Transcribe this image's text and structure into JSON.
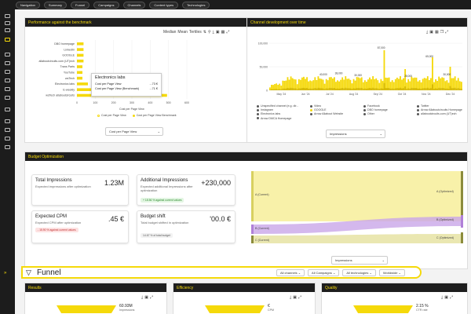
{
  "topbar": {
    "buttons": [
      "Navigation",
      "Summary",
      "Funnel",
      "Campaigns",
      "Channels",
      "Content types",
      "Technologies"
    ]
  },
  "benchmark": {
    "title": "Performance against the benchmark",
    "toolbar": [
      "Median",
      "Mean",
      "Tertiles"
    ],
    "labels": [
      "DBO homepage",
      "LinkedIn",
      "GOOGLE",
      "allaboutcircuits.com (UT)ech",
      "Trans Parts",
      "YouTube",
      "wsTech",
      "Electronics labs",
      "E-weekly",
      "wsTech allaboutcircuits"
    ],
    "bar_fractions": [
      0.06,
      0.06,
      0.06,
      0.06,
      0.05,
      0.05,
      0.05,
      0.1,
      0.33,
      0.82
    ],
    "x_ticks": [
      "0",
      "100",
      "200",
      "300",
      "400",
      "500",
      "600"
    ],
    "x_label": "Cost per Page View",
    "legend": [
      "Cost per Page View",
      "Cost per Page View Benchmark"
    ],
    "select": "Cost per Page View",
    "tooltip": {
      "title": "Electronics labs",
      "rows": [
        {
          "label": "Cost per Page View",
          "value": "...73 €"
        },
        {
          "label": "Cost per Page View (Benchmark)",
          "value": "...71 €"
        }
      ]
    }
  },
  "channel": {
    "title": "Channel development over time",
    "y_ticks": [
      "100,000",
      "50,000",
      "0"
    ],
    "x_ticks": [
      "May '24",
      "Jun '24",
      "Jul '24",
      "Aug '24",
      "Sep '24",
      "Oct '24",
      "Nov '24",
      "Dec '24"
    ],
    "annotations": [
      "40,000",
      "38,000",
      "87,000",
      "65,000",
      "30,000",
      "28,000",
      "30,000"
    ],
    "legend": [
      "Unspecified channel (e.g. dir...",
      "Video",
      "Facebook",
      "Twitter",
      "Instagram",
      "GOOGLE",
      "DBO homepage",
      "Arrow Allaboutcircuits Homepage",
      "Electronics labs",
      "Arrow Allabout Website",
      "Other",
      "allaboutcircuits.com (UT)ech",
      "Arrow DMCA Homepage"
    ],
    "legend_colors": [
      "#555555",
      "#555555",
      "#555555",
      "#555555",
      "#555555",
      "#f5d90a",
      "#555555",
      "#555555",
      "#555555",
      "#555555",
      "#555555",
      "#555555",
      "#555555"
    ],
    "select": "Impressions"
  },
  "budget": {
    "title": "Budget Optimization",
    "kpis": [
      {
        "title": "Total Impressions",
        "sub": "Expected impressions after optimization",
        "value": "1.23M"
      },
      {
        "title": "Additional Impressions",
        "sub": "Expected additional Impressions after optimization",
        "value": "+230,000",
        "badge": "+ 18.56 % against current values"
      },
      {
        "title": "Expected CPM",
        "sub": "Expected CPM after optimization",
        "value": ".45 €",
        "badge": "- 15.90 % against current values"
      },
      {
        "title": "Budget shift",
        "sub": "Total budget shifted in optimization",
        "value": "'00.0 €",
        "badge": "14.67 % of total budget"
      }
    ],
    "sankey_left": [
      "A (Current)",
      "B (Current)",
      "C (Current)"
    ],
    "sankey_right": [
      "A (Optimized)",
      "B (Optimized)",
      "C (Optimized)"
    ],
    "select": "Impressions"
  },
  "funnel": {
    "title": "Funnel",
    "filters": [
      "All channels",
      "All Campaigns",
      "All technologies",
      "Worldwide"
    ]
  },
  "bottom_cards": [
    {
      "title": "Results",
      "value": "60.93M",
      "sub": "Impressions"
    },
    {
      "title": "Efficiency",
      "value": "€",
      "sub": "CPM"
    },
    {
      "title": "Quality",
      "value": "2.15 %",
      "sub": "CTR rate"
    }
  ],
  "colors": {
    "accent": "#f5d90a",
    "dark": "#1c1c1c",
    "purple": "#c9a6e8",
    "olive": "#8c8c3c"
  }
}
